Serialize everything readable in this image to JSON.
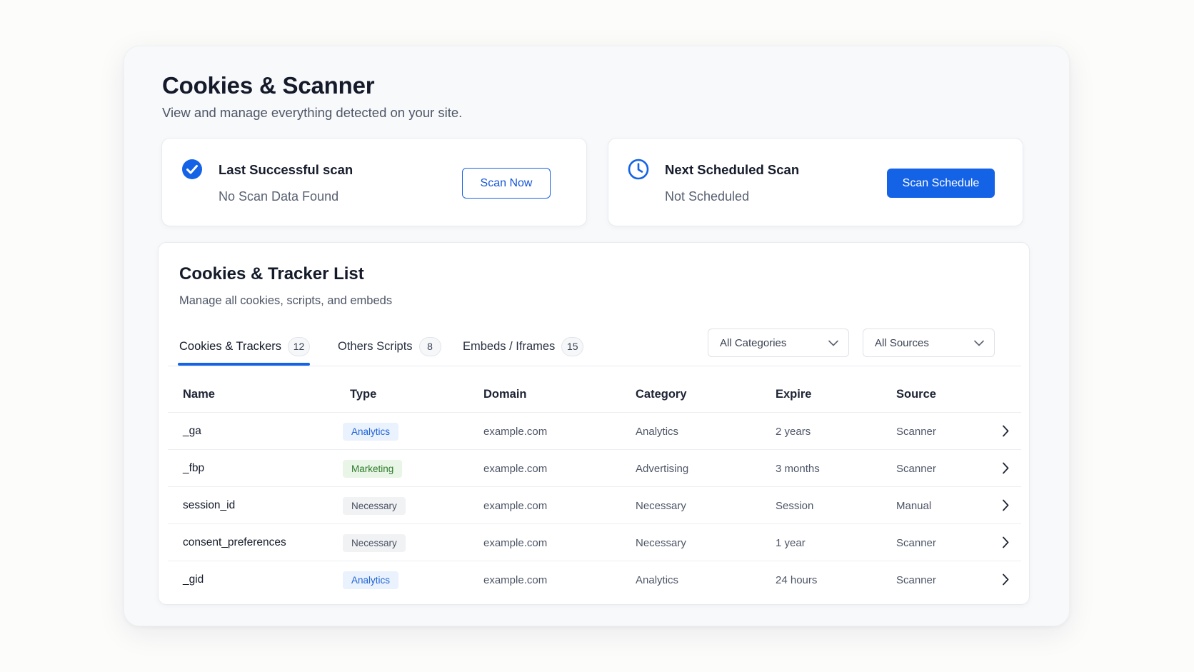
{
  "header": {
    "title": "Cookies & Scanner",
    "subtitle": "View and manage everything detected on your site."
  },
  "last_scan": {
    "icon": "check-circle-icon",
    "label": "Last Successful scan",
    "value": "No Scan Data Found",
    "button_label": "Scan Now"
  },
  "next_scan": {
    "icon": "clock-icon",
    "label": "Next Scheduled Scan",
    "value": "Not Scheduled",
    "button_label": "Scan Schedule"
  },
  "list": {
    "title": "Cookies & Tracker List",
    "subtitle": "Manage all cookies, scripts, and embeds",
    "tabs": [
      {
        "label": "Cookies & Trackers",
        "count": "12",
        "active": true
      },
      {
        "label": "Others Scripts",
        "count": "8",
        "active": false
      },
      {
        "label": "Embeds / Iframes",
        "count": "15",
        "active": false
      }
    ],
    "filters": {
      "category": "All Categories",
      "source": "All Sources"
    },
    "columns": [
      "Name",
      "Type",
      "Domain",
      "Category",
      "Expire",
      "Source"
    ],
    "rows": [
      {
        "name": "_ga",
        "type": "Analytics",
        "domain": "example.com",
        "category": "Analytics",
        "expire": "2 years",
        "source": "Scanner"
      },
      {
        "name": "_fbp",
        "type": "Marketing",
        "domain": "example.com",
        "category": "Advertising",
        "expire": "3 months",
        "source": "Scanner"
      },
      {
        "name": "session_id",
        "type": "Necessary",
        "domain": "example.com",
        "category": "Necessary",
        "expire": "Session",
        "source": "Manual"
      },
      {
        "name": "consent_preferences",
        "type": "Necessary",
        "domain": "example.com",
        "category": "Necessary",
        "expire": "1 year",
        "source": "Scanner"
      },
      {
        "name": "_gid",
        "type": "Analytics",
        "domain": "example.com",
        "category": "Analytics",
        "expire": "24 hours",
        "source": "Scanner"
      }
    ]
  },
  "colors": {
    "accent": "#1463e6",
    "analytics_bg": "#eaf2fd",
    "analytics_fg": "#1e63d6",
    "marketing_bg": "#e9f6e7",
    "marketing_fg": "#2f7a2c",
    "necessary_bg": "#f1f2f4",
    "necessary_fg": "#4a5162"
  }
}
